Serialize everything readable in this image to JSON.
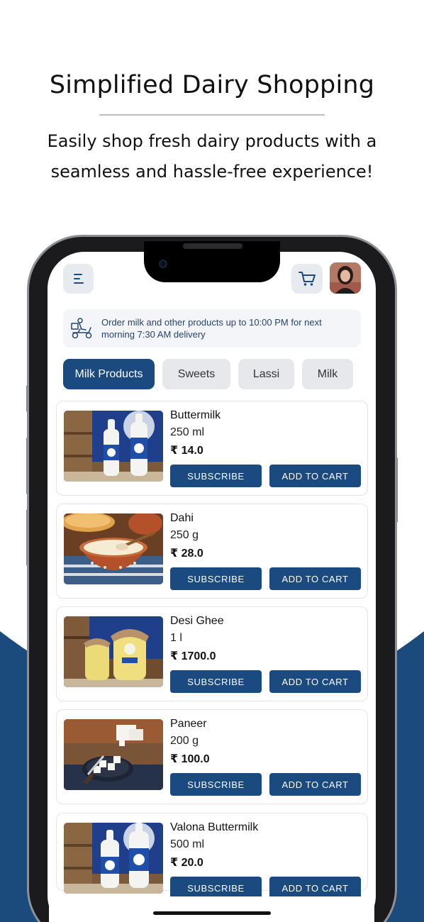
{
  "hero": {
    "title": "Simplified Dairy Shopping",
    "subtitle": "Easily shop fresh dairy products with a seamless and hassle-free experience!"
  },
  "colors": {
    "brand": "#1a4a80",
    "tab_inactive": "#e6e8eb",
    "banner_bg": "#f3f5f8",
    "wave": "#1b4a7d"
  },
  "header": {
    "menu_icon": "menu-icon",
    "cart_icon": "cart-icon",
    "avatar": "profile-avatar"
  },
  "banner": {
    "icon": "delivery-scooter-icon",
    "text": "Order milk and other products up to 10:00 PM for next morning 7:30 AM delivery"
  },
  "tabs": [
    {
      "label": "Milk Products",
      "active": true
    },
    {
      "label": "Sweets",
      "active": false
    },
    {
      "label": "Lassi",
      "active": false
    },
    {
      "label": "Milk",
      "active": false
    }
  ],
  "products": [
    {
      "name": "Buttermilk",
      "qty": "250 ml",
      "price": "₹ 14.0",
      "subscribe": "SUBSCRIBE",
      "add": "ADD TO CART"
    },
    {
      "name": "Dahi",
      "qty": "250 g",
      "price": "₹ 28.0",
      "subscribe": "SUBSCRIBE",
      "add": "ADD TO CART"
    },
    {
      "name": "Desi Ghee",
      "qty": "1 l",
      "price": "₹ 1700.0",
      "subscribe": "SUBSCRIBE",
      "add": "ADD TO CART"
    },
    {
      "name": "Paneer",
      "qty": "200 g",
      "price": "₹ 100.0",
      "subscribe": "SUBSCRIBE",
      "add": "ADD TO CART"
    },
    {
      "name": "Valona Buttermilk",
      "qty": "500 ml",
      "price": "₹ 20.0",
      "subscribe": "SUBSCRIBE",
      "add": "ADD TO CART"
    }
  ]
}
